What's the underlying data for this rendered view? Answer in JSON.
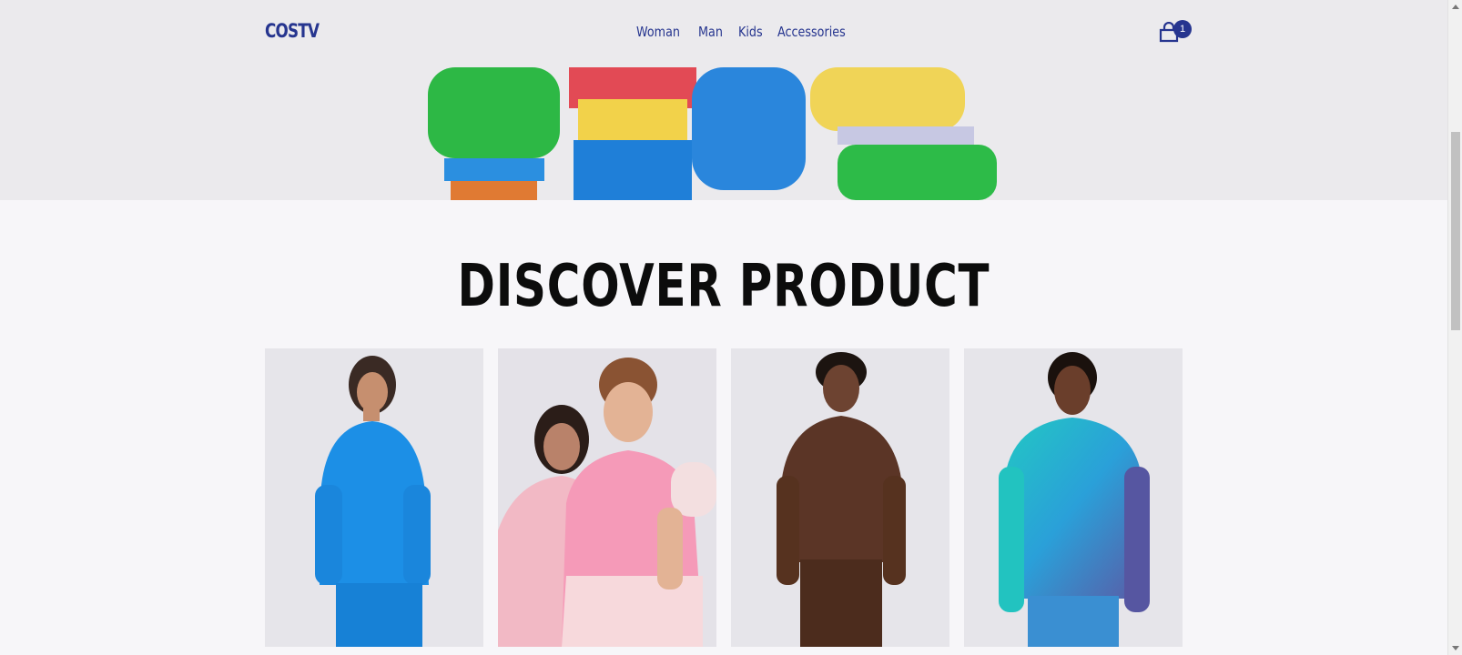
{
  "brand": "COSTV",
  "nav": {
    "items": [
      "Woman",
      "Man",
      "Kids",
      "Accessories"
    ]
  },
  "cart": {
    "count": "1"
  },
  "headline": "DISCOVER PRODUCT",
  "colors": {
    "accent": "#26358f",
    "text": "#0c0c0c",
    "badge": "#26358f"
  },
  "products": [
    {
      "icon": "woman-blue-puffer-jacket-photo"
    },
    {
      "icon": "couple-pink-hoodie-photo"
    },
    {
      "icon": "man-brown-hoodie-photo"
    },
    {
      "icon": "man-blue-gradient-sweatshirt-photo"
    }
  ]
}
